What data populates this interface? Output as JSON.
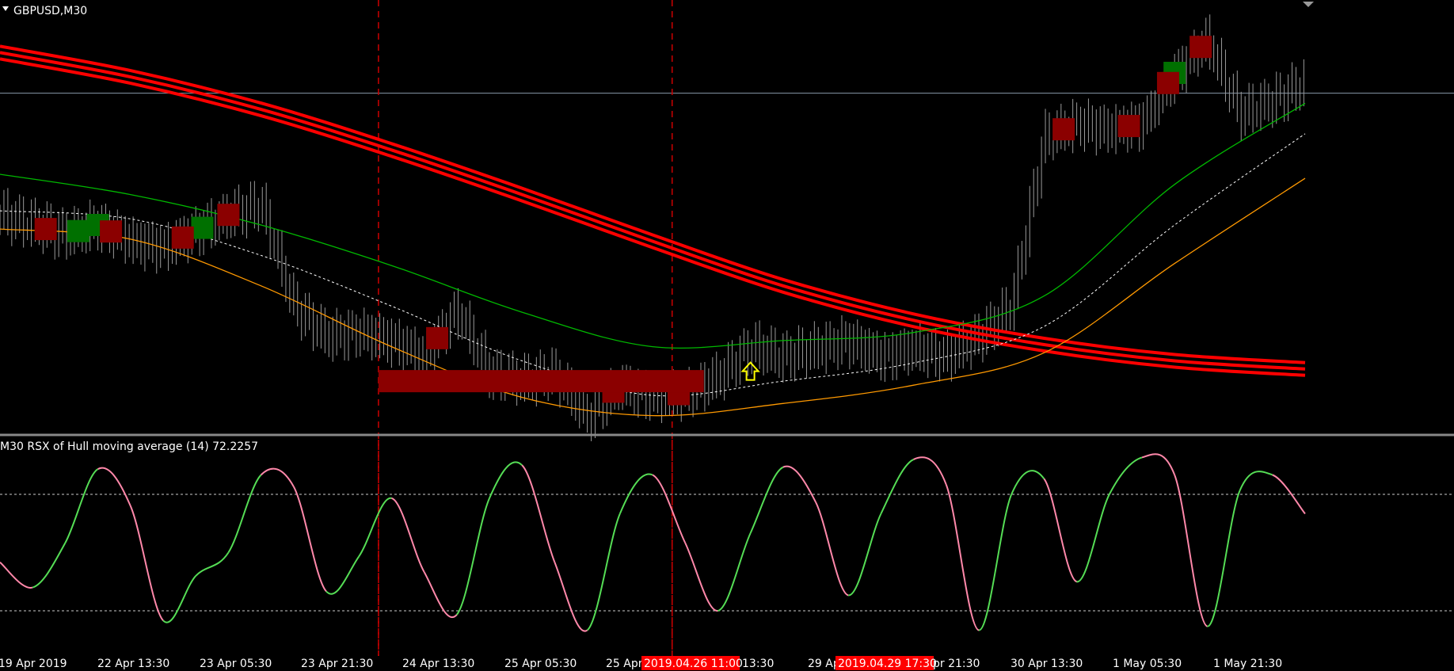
{
  "window": {
    "symbol_title": "GBPUSD,M30",
    "indicator_title": "M30 RSX of Hull moving average (14) 72.2257"
  },
  "colors": {
    "background": "#000000",
    "text": "#ffffff",
    "bars": "#9a9a9a",
    "red_ma": "#ff0000",
    "green_ma": "#00b800",
    "orange_ma": "#ff9900",
    "dotted_ma": "#ffffff",
    "bull_box": "#007000",
    "bear_box": "#8b0000",
    "vline": "#cc0000",
    "arrow": "#ffff00",
    "rsx_up": "#55dd55",
    "rsx_down": "#ff88aa",
    "label_highlight": "#ff0000"
  },
  "time_axis": {
    "labels": [
      "19 Apr 2019",
      "22 Apr 13:30",
      "23 Apr 05:30",
      "23 Apr 21:30",
      "24 Apr 13:30",
      "25 Apr 05:30",
      "25 Apr",
      "13:30",
      "29 Ap",
      "pr 21:30",
      "30 Apr 13:30",
      "1 May 05:30",
      "1 May 21:30"
    ],
    "highlighted": [
      "2019.04.26 11:00",
      "2019.04.29 17:30"
    ]
  },
  "chart_data": [
    {
      "type": "line",
      "title": "GBPUSD,M30",
      "x": [
        0,
        20,
        40,
        60,
        80,
        100,
        120,
        140,
        160,
        180,
        200
      ],
      "series": [
        {
          "values": [
            1.302,
            1.3008,
            1.2992,
            1.2972,
            1.295,
            1.2927,
            1.2905,
            1.2888,
            1.2876,
            1.2868,
            1.2864
          ]
        },
        {
          "values": [
            1.296,
            1.295,
            1.2935,
            1.2915,
            1.2892,
            1.2875,
            1.2878,
            1.2882,
            1.29,
            1.2955,
            1.2995
          ]
        },
        {
          "values": [
            1.2942,
            1.2938,
            1.292,
            1.2895,
            1.2868,
            1.2851,
            1.2858,
            1.2867,
            1.2885,
            1.2935,
            1.298
          ]
        },
        {
          "values": [
            1.2933,
            1.2928,
            1.2905,
            1.2875,
            1.285,
            1.2841,
            1.2847,
            1.2856,
            1.2872,
            1.2916,
            1.2958
          ]
        }
      ],
      "bars": {
        "x": [
          0,
          5,
          10,
          15,
          20,
          25,
          30,
          35,
          40,
          45,
          50,
          55,
          60,
          65,
          70,
          75,
          80,
          85,
          90,
          95,
          100,
          105,
          110,
          115,
          120,
          125,
          130,
          135,
          140,
          145,
          150,
          155,
          160,
          165,
          170,
          175,
          180,
          185,
          190,
          195,
          200
        ],
        "close": [
          1.294,
          1.2935,
          1.293,
          1.2935,
          1.2927,
          1.2924,
          1.2932,
          1.294,
          1.2945,
          1.2895,
          1.288,
          1.2882,
          1.2878,
          1.287,
          1.2893,
          1.2862,
          1.2858,
          1.2862,
          1.284,
          1.2856,
          1.285,
          1.2852,
          1.286,
          1.2875,
          1.287,
          1.2874,
          1.2878,
          1.287,
          1.2874,
          1.287,
          1.288,
          1.2895,
          1.2978,
          1.2985,
          1.2982,
          1.2985,
          1.301,
          1.3026,
          1.299,
          1.2996,
          1.3005
        ]
      },
      "markers": {
        "bull": [
          12,
          15,
          31,
          180
        ],
        "bear": [
          7,
          17,
          28,
          35,
          67,
          80,
          94,
          104,
          163,
          173,
          179,
          184
        ],
        "arrow_up": [
          115
        ]
      },
      "level": 1.3,
      "vlines": [
        58,
        103
      ],
      "ylim": [
        1.2835,
        1.3035
      ]
    },
    {
      "type": "line",
      "title": "M30 RSX of Hull moving average (14) 72.2257",
      "x": [
        0,
        5,
        10,
        15,
        20,
        25,
        30,
        35,
        40,
        45,
        50,
        55,
        60,
        65,
        70,
        75,
        80,
        85,
        90,
        95,
        100,
        105,
        110,
        115,
        120,
        125,
        130,
        135,
        140,
        145,
        150,
        155,
        160,
        165,
        170,
        175,
        180,
        185,
        190,
        195,
        200
      ],
      "values": [
        45,
        32,
        55,
        93,
        74,
        15,
        38,
        50,
        90,
        84,
        30,
        48,
        78,
        40,
        18,
        78,
        95,
        45,
        10,
        70,
        90,
        55,
        20,
        60,
        94,
        76,
        28,
        70,
        98,
        85,
        10,
        80,
        88,
        35,
        80,
        99,
        90,
        12,
        82,
        90,
        70
      ],
      "levels": [
        80,
        20
      ],
      "ylim": [
        0,
        100
      ],
      "last_value": 72.2257
    }
  ]
}
